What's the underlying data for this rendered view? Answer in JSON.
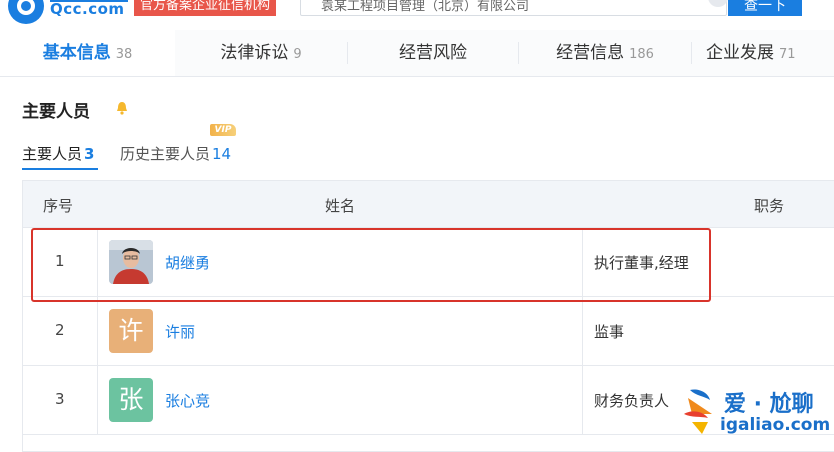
{
  "header": {
    "logo_text": "Qcc.com",
    "official_badge": "官方备案企业征信机构",
    "search_value": "袁某工程项目管理（北京）有限公司",
    "search_button": "查一下"
  },
  "tabs": [
    {
      "label": "基本信息",
      "count": "38",
      "active": true
    },
    {
      "label": "法律诉讼",
      "count": "9",
      "active": false
    },
    {
      "label": "经营风险",
      "count": "",
      "active": false
    },
    {
      "label": "经营信息",
      "count": "186",
      "active": false
    },
    {
      "label": "企业发展",
      "count": "71",
      "active": false
    }
  ],
  "section": {
    "title": "主要人员",
    "subtabs": [
      {
        "label": "主要人员",
        "count": "3",
        "active": true
      },
      {
        "label": "历史主要人员",
        "count": "14",
        "active": false
      }
    ],
    "vip_badge": "VIP"
  },
  "table": {
    "headers": {
      "index": "序号",
      "name": "姓名",
      "role": "职务"
    },
    "rows": [
      {
        "index": "1",
        "avatar_char": "",
        "avatar_color": "#c9d3dd",
        "name": "胡继勇",
        "role": "执行董事,经理"
      },
      {
        "index": "2",
        "avatar_char": "许",
        "avatar_color": "#e8b078",
        "name": "许丽",
        "role": "监事"
      },
      {
        "index": "3",
        "avatar_char": "张",
        "avatar_color": "#6cc3a0",
        "name": "张心竞",
        "role": "财务负责人"
      }
    ]
  },
  "watermark": {
    "title": "爱 · 尬聊",
    "url": "igaliao.com"
  },
  "colors": {
    "brand_blue": "#1a7ee0",
    "highlight_red": "#d8342b",
    "badge_red": "#e8564a"
  }
}
